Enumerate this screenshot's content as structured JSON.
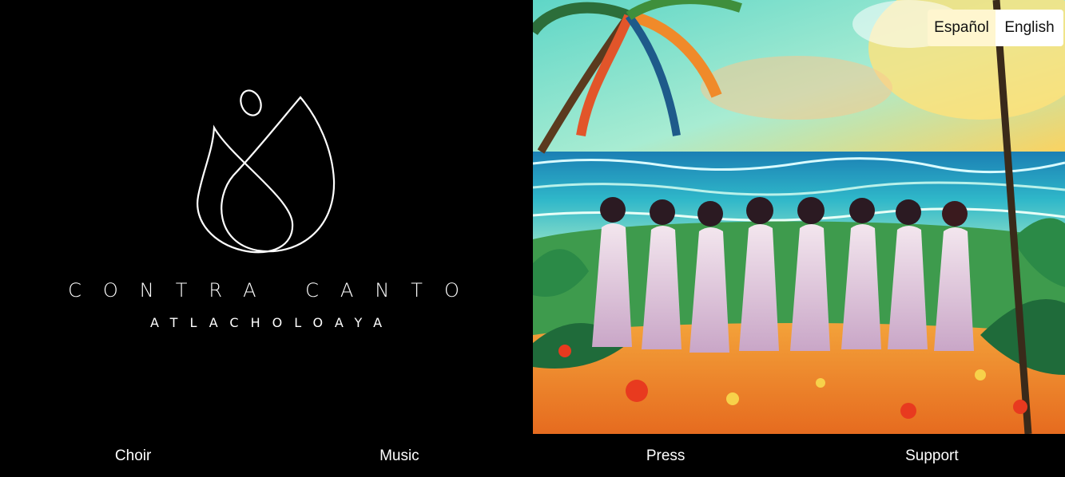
{
  "brand": {
    "title": "CONTRA CANTO",
    "subtitle": "ATLACHOLOAYA",
    "icon": "flame-drops-logo"
  },
  "language": {
    "options": [
      "Español",
      "English"
    ],
    "selected": "English"
  },
  "nav": {
    "items": [
      {
        "label": "Choir"
      },
      {
        "label": "Music"
      },
      {
        "label": "Press"
      },
      {
        "label": "Support"
      }
    ]
  },
  "colors": {
    "background": "#000000",
    "text": "#ffffff",
    "lang_bg": "#fff6cf"
  }
}
